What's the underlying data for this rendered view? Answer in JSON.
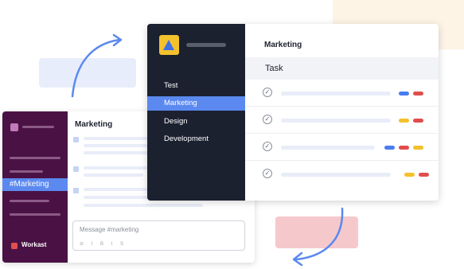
{
  "slack": {
    "channel_label": "#Marketing",
    "title": "Marketing",
    "brand": "Workast",
    "composer_placeholder": "Message #marketing",
    "composer_tools": "⊘ I B I S"
  },
  "workast": {
    "title": "Marketing",
    "task_header": "Task",
    "nav": [
      {
        "label": "Test"
      },
      {
        "label": "Marketing"
      },
      {
        "label": "Design"
      },
      {
        "label": "Development"
      }
    ],
    "rows": [
      {
        "done": true,
        "tags": [
          "blue",
          "red"
        ]
      },
      {
        "done": true,
        "tags": [
          "yellow",
          "red"
        ]
      },
      {
        "done": true,
        "tags": [
          "blue",
          "red",
          "yellow"
        ]
      },
      {
        "done": true,
        "tags": [
          "yellow",
          "red"
        ]
      }
    ]
  },
  "colors": {
    "accent": "#5b89ef",
    "slack_sidebar": "#4a1244",
    "workast_sidebar": "#1c2130",
    "arrow": "#5b89ef"
  }
}
